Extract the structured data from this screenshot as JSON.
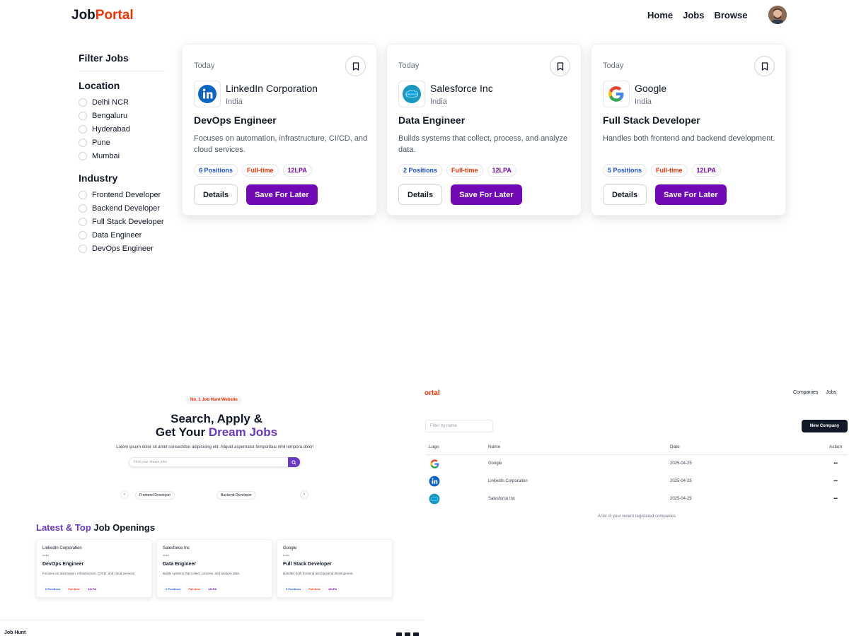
{
  "topnav": {
    "logo_part1": "Job",
    "logo_part2": "Portal",
    "links": [
      "Home",
      "Jobs",
      "Browse"
    ]
  },
  "filter": {
    "title": "Filter Jobs",
    "groups": [
      {
        "title": "Location",
        "options": [
          "Delhi NCR",
          "Bengaluru",
          "Hyderabad",
          "Pune",
          "Mumbai"
        ]
      },
      {
        "title": "Industry",
        "options": [
          "Frontend Developer",
          "Backend Developer",
          "Full Stack Developer",
          "Data Engineer",
          "DevOps Engineer"
        ]
      }
    ]
  },
  "jobs": [
    {
      "when": "Today",
      "company": "LinkedIn Corporation",
      "location": "India",
      "role": "DevOps Engineer",
      "desc": "Focuses on automation, infrastructure, CI/CD, and cloud services.",
      "positions": "6 Positions",
      "type": "Full-time",
      "salary": "12LPA",
      "details": "Details",
      "save": "Save For Later"
    },
    {
      "when": "Today",
      "company": "Salesforce Inc",
      "location": "India",
      "role": "Data Engineer",
      "desc": "Builds systems that collect, process, and analyze data.",
      "positions": "2 Positions",
      "type": "Full-time",
      "salary": "12LPA",
      "details": "Details",
      "save": "Save For Later"
    },
    {
      "when": "Today",
      "company": "Google",
      "location": "India",
      "role": "Full Stack Developer",
      "desc": "Handles both frontend and backend development.",
      "positions": "5 Positions",
      "type": "Full-time",
      "salary": "12LPA",
      "details": "Details",
      "save": "Save For Later"
    }
  ],
  "home": {
    "pill": "No. 1 Job Hunt Website",
    "h1_line1": "Search, Apply &",
    "h1_line2_a": "Get Your ",
    "h1_line2_b": "Dream Jobs",
    "sub": "Lorem ipsum dolor sit amet consectetur adipisicing elit. Aliquid aspernatur temporibus nihil tempora dolor!",
    "search_placeholder": "Find your dream jobs",
    "carousel": [
      "Frontend Developer",
      "Backend Developer"
    ],
    "latest_a": "Latest & Top",
    "latest_b": " Job Openings",
    "mini_jobs": [
      {
        "company": "LinkedIn Corporation",
        "location": "India",
        "role": "DevOps Engineer",
        "desc": "Focuses on automation, infrastructure, CI/CD, and cloud services.",
        "positions": "6 Positions",
        "type": "Full-time",
        "salary": "12LPA"
      },
      {
        "company": "Salesforce Inc",
        "location": "India",
        "role": "Data Engineer",
        "desc": "Builds systems that collect, process, and analyze data.",
        "positions": "2 Positions",
        "type": "Full-time",
        "salary": "12LPA"
      },
      {
        "company": "Google",
        "location": "India",
        "role": "Full Stack Developer",
        "desc": "Handles both frontend and backend development.",
        "positions": "5 Positions",
        "type": "Full-time",
        "salary": "12LPA"
      }
    ],
    "footer_title": "Job Hunt"
  },
  "admin": {
    "logo": "ortal",
    "nav": [
      "Companies",
      "Jobs"
    ],
    "filter_placeholder": "Filter by name",
    "new_company": "New Company",
    "headers": {
      "logo": "Logo",
      "name": "Name",
      "date": "Date",
      "action": "Action"
    },
    "rows": [
      {
        "name": "Google",
        "date": "2025-04-25",
        "action": "..."
      },
      {
        "name": "LinkedIn Corporation",
        "date": "2025-04-25",
        "action": "..."
      },
      {
        "name": "Salesforce Inc",
        "date": "2025-04-25",
        "action": "..."
      }
    ],
    "caption": "A list of your recent registered companies"
  },
  "colors": {
    "brand_red": "#f83002",
    "brand_purple": "#7209b7",
    "hero_purple": "#6a38c2"
  }
}
